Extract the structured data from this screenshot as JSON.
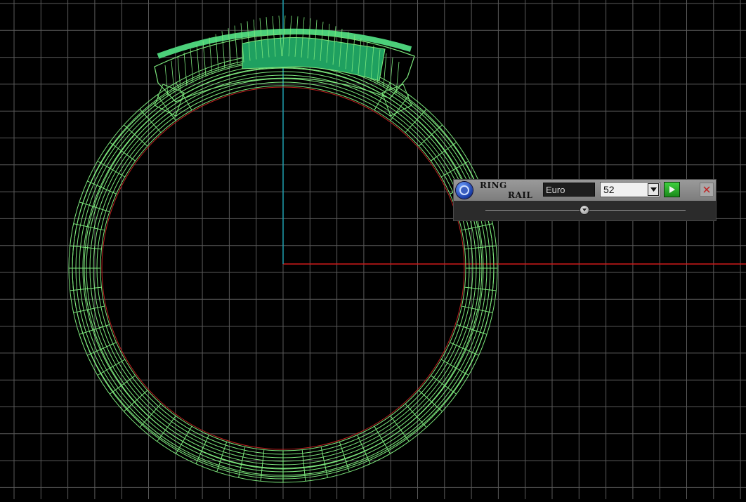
{
  "panel": {
    "title_line1": "RING",
    "title_line2": "RAIL",
    "standard": "Euro",
    "size": "52",
    "icons": {
      "logo": "ring-logo-icon",
      "dropdown": "chevron-down-icon",
      "apply": "play-icon",
      "close": "close-icon"
    }
  },
  "viewport": {
    "background_color": "#000000",
    "grid_color": "#5a5a5a",
    "x_axis_color": "#d01a1a",
    "y_axis_color": "#1fa0b0",
    "wireframe_color": "#7de87d",
    "gem_fill_color": "#1fa060",
    "inner_circle_color": "#c02020"
  }
}
